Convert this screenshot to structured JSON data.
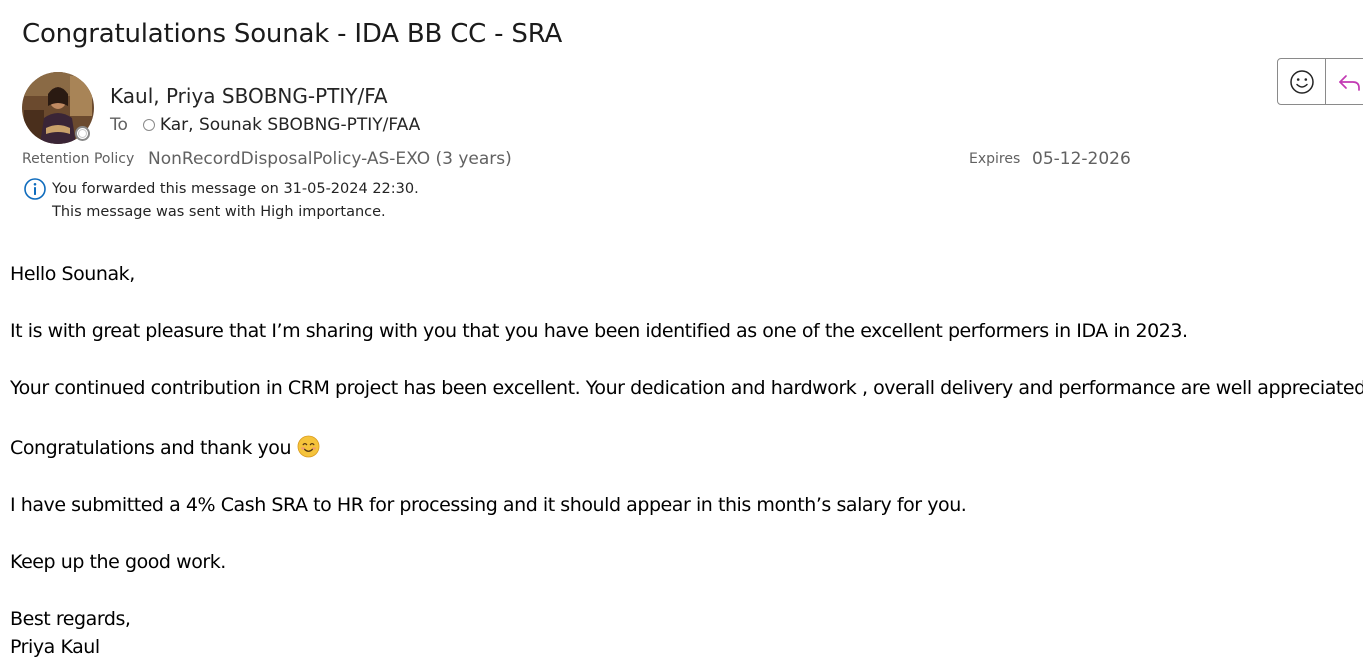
{
  "subject": "Congratulations Sounak - IDA BB CC - SRA",
  "sender": {
    "name": "Kaul, Priya SBOBNG-PTIY/FA",
    "avatar_icon": "profile-photo"
  },
  "recipients": {
    "label": "To",
    "name": "Kar, Sounak SBOBNG-PTIY/FAA"
  },
  "retention": {
    "label": "Retention Policy",
    "value": "NonRecordDisposalPolicy-AS-EXO (3 years)",
    "expires_label": "Expires",
    "expires_value": "05-12-2026"
  },
  "info": {
    "icon": "info-icon",
    "forwarded": "You forwarded this message on 31-05-2024 22:30.",
    "importance": "This message was sent with High importance."
  },
  "actions": {
    "emoji_icon": "smiley-icon",
    "reply_icon": "reply-icon"
  },
  "body": {
    "greeting": "Hello Sounak,",
    "para1": "It is with great pleasure that I’m sharing with you that you have been identified as one of the excellent performers in IDA in 2023.",
    "para2": "Your continued contribution in CRM project has been excellent. Your dedication and hardwork , overall delivery and performance are well appreciated.",
    "para3": "Congratulations and thank you",
    "para3_emoji": "smiling-face-emoji",
    "para4": "I have submitted a 4% Cash SRA to HR for processing and it should appear in this month’s salary for you.",
    "para5": "Keep up the good work.",
    "closing": "Best regards,",
    "signature": "Priya Kaul"
  },
  "colors": {
    "text": "#242424",
    "muted": "#616161",
    "info_icon": "#0f6cbd",
    "reply_icon": "#c239b3",
    "emoji": "#f5c33b"
  }
}
